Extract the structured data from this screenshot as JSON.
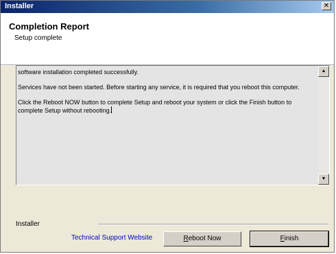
{
  "window": {
    "title": "Installer",
    "close_glyph": "✕"
  },
  "header": {
    "title": "Completion Report",
    "subtitle": "Setup complete"
  },
  "report": {
    "paragraphs": [
      "software installation completed successfully.",
      "Services have not been started.  Before starting any service, it is required that you reboot this computer.",
      "Click the Reboot NOW button to complete Setup and reboot your system or click the Finish button to complete Setup without rebooting."
    ],
    "scroll_up_glyph": "▲",
    "scroll_down_glyph": "▼"
  },
  "footer": {
    "group_label": "Installer",
    "support_link": "Technical Support Website",
    "reboot_button": {
      "accel": "R",
      "rest": "eboot Now"
    },
    "finish_button": {
      "accel": "F",
      "rest": "inish"
    }
  },
  "icons": {
    "close": "close-icon",
    "scroll_up": "scroll-up-icon",
    "scroll_down": "scroll-down-icon"
  }
}
